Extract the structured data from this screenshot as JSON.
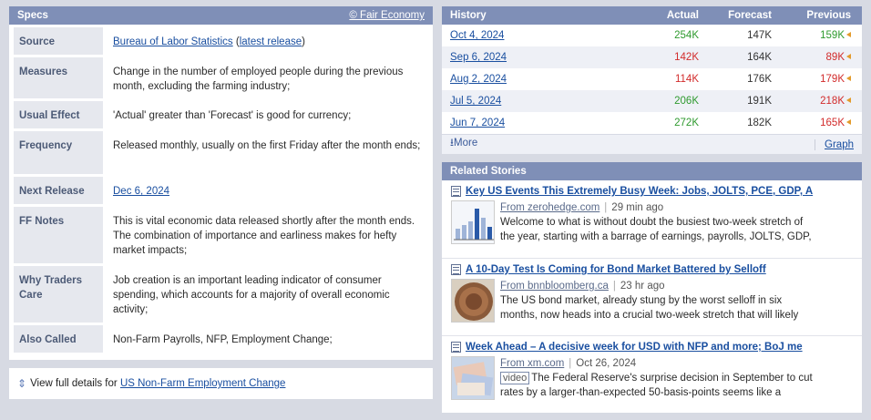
{
  "specs": {
    "title": "Specs",
    "source_link": "© Fair Economy",
    "rows": {
      "source": {
        "label": "Source",
        "link": "Bureau of Labor Statistics",
        "pre_paren": " (",
        "link2": "latest release",
        "post_paren": ")"
      },
      "measures": {
        "label": "Measures",
        "value": "Change in the number of employed people during the previous month, excluding the farming industry;"
      },
      "usual_effect": {
        "label": "Usual Effect",
        "value": "'Actual' greater than 'Forecast' is good for currency;"
      },
      "frequency": {
        "label": "Frequency",
        "value": "Released monthly, usually on the first Friday after the month ends;"
      },
      "next_release": {
        "label": "Next Release",
        "value": "Dec 6, 2024"
      },
      "ff_notes": {
        "label": "FF Notes",
        "value": "This is vital economic data released shortly after the month ends. The combination of importance and earliness makes for hefty market impacts;"
      },
      "why_traders_care": {
        "label": "Why Traders Care",
        "value": "Job creation is an important leading indicator of consumer spending, which accounts for a majority of overall economic activity;"
      },
      "also_called": {
        "label": "Also Called",
        "value": "Non-Farm Payrolls, NFP, Employment Change;"
      }
    }
  },
  "full_details": {
    "prefix": "View full details for ",
    "link": "US Non-Farm Employment Change"
  },
  "history": {
    "headers": {
      "date": "History",
      "actual": "Actual",
      "forecast": "Forecast",
      "previous": "Previous"
    },
    "rows": [
      {
        "date": "Oct 4, 2024",
        "actual": "254K",
        "forecast": "147K",
        "previous": "159K"
      },
      {
        "date": "Sep 6, 2024",
        "actual": "142K",
        "forecast": "164K",
        "previous": "89K"
      },
      {
        "date": "Aug 2, 2024",
        "actual": "114K",
        "forecast": "176K",
        "previous": "179K"
      },
      {
        "date": "Jul 5, 2024",
        "actual": "206K",
        "forecast": "191K",
        "previous": "218K"
      },
      {
        "date": "Jun 7, 2024",
        "actual": "272K",
        "forecast": "182K",
        "previous": "165K"
      }
    ],
    "more": "More",
    "graph": "Graph",
    "colors": {
      "better": "#2f9a2f",
      "worse": "#d22b2b",
      "revision_flag": "#e39a2a"
    }
  },
  "stories": {
    "title": "Related Stories",
    "items": [
      {
        "title": "Key US Events This Extremely Busy Week: Jobs, JOLTS, PCE, GDP, A",
        "from": "From zerohedge.com",
        "time": "29 min ago",
        "line1": "Welcome to what is without doubt the busiest two-week stretch of",
        "line2": "the year, starting with a barrage of earnings, payrolls, JOLTS, GDP,"
      },
      {
        "title": "A 10-Day Test Is Coming for Bond Market Battered by Selloff",
        "from": "From bnnbloomberg.ca",
        "time": "23 hr ago",
        "line1": "The US bond market, already stung by the worst selloff in six",
        "line2": "months, now heads into a crucial two-week stretch that will likely"
      },
      {
        "title": "Week Ahead – A decisive week for USD with NFP and more; BoJ me",
        "from": "From xm.com",
        "time": "Oct 26, 2024",
        "tag": "video",
        "line1": "The Federal Reserve's surprise decision in September to cut",
        "line2": "rates by a larger-than-expected 50-basis-points seems like a"
      }
    ]
  }
}
